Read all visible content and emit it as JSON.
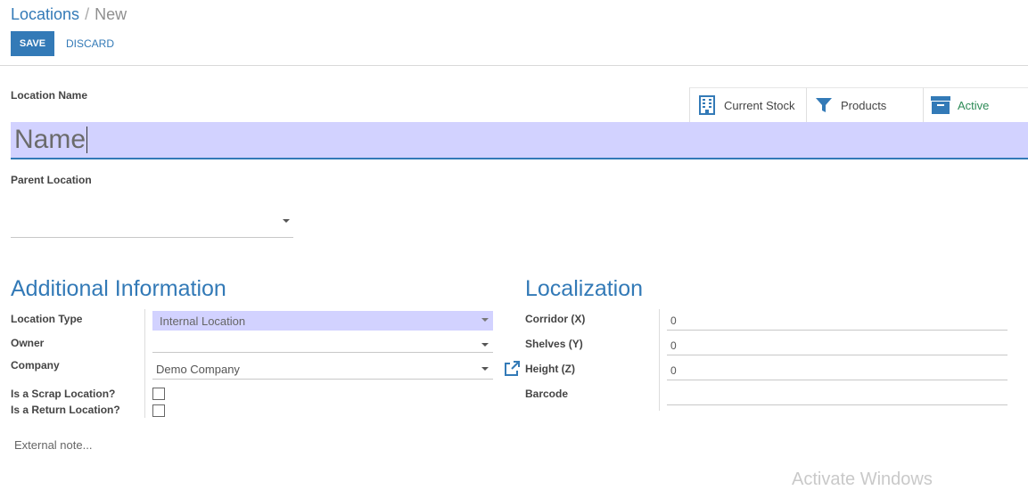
{
  "breadcrumb": {
    "parent": "Locations",
    "separator": "/",
    "current": "New"
  },
  "toolbar": {
    "save_label": "SAVE",
    "discard_label": "DISCARD"
  },
  "form": {
    "location_name_label": "Location Name",
    "name_placeholder": "Name",
    "parent_location_label": "Parent Location",
    "parent_location_value": ""
  },
  "smart_buttons": [
    {
      "label": "Current Stock",
      "icon": "building-icon"
    },
    {
      "label": "Products",
      "icon": "filter-icon"
    },
    {
      "label": "Active",
      "icon": "archive-icon"
    }
  ],
  "additional_info": {
    "title": "Additional Information",
    "location_type_label": "Location Type",
    "location_type_value": "Internal Location",
    "owner_label": "Owner",
    "owner_value": "",
    "company_label": "Company",
    "company_value": "Demo Company",
    "scrap_label": "Is a Scrap Location?",
    "return_label": "Is a Return Location?"
  },
  "localization": {
    "title": "Localization",
    "corridor_label": "Corridor (X)",
    "corridor_value": "0",
    "shelves_label": "Shelves (Y)",
    "shelves_value": "0",
    "height_label": "Height (Z)",
    "height_value": "0",
    "barcode_label": "Barcode",
    "barcode_value": ""
  },
  "external_note_placeholder": "External note...",
  "watermark": "Activate Windows",
  "colors": {
    "accent": "#337ab7",
    "input_highlight": "#d2d2ff",
    "active_green": "#2e8b57"
  }
}
